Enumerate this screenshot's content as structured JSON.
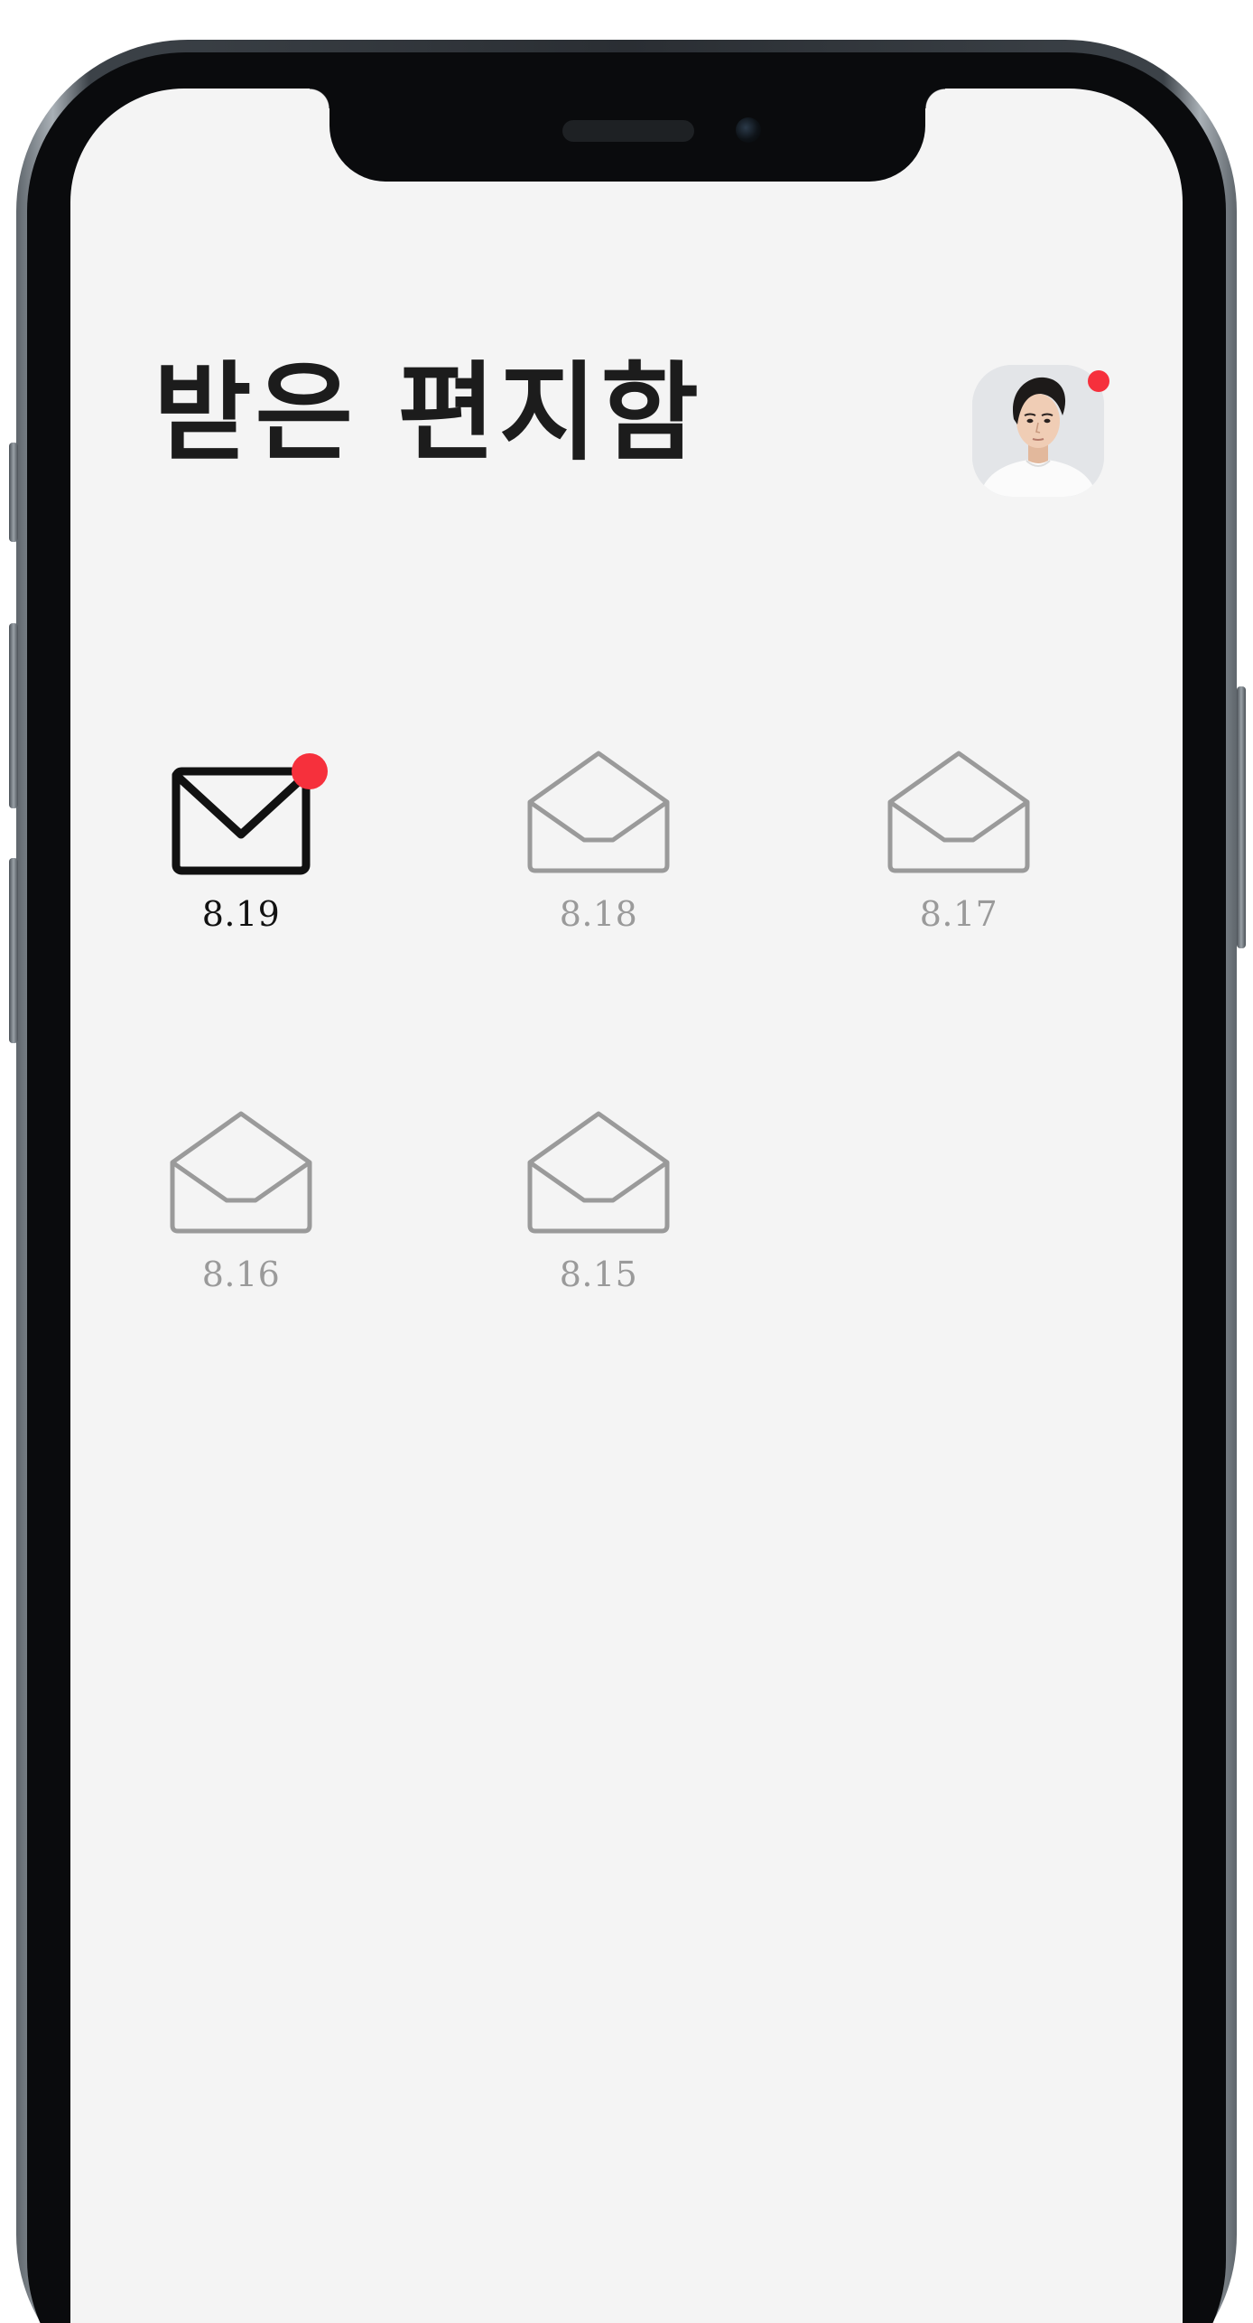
{
  "inbox": {
    "title": "받은 편지함",
    "profile": {
      "has_notification": true,
      "notification_color": "#f6303c"
    },
    "letters": [
      {
        "date": "8.19",
        "status": "unread",
        "icon": "closed-envelope-icon",
        "has_new_badge": true
      },
      {
        "date": "8.18",
        "status": "read",
        "icon": "open-envelope-icon",
        "has_new_badge": false
      },
      {
        "date": "8.17",
        "status": "read",
        "icon": "open-envelope-icon",
        "has_new_badge": false
      },
      {
        "date": "8.16",
        "status": "read",
        "icon": "open-envelope-icon",
        "has_new_badge": false
      },
      {
        "date": "8.15",
        "status": "read",
        "icon": "open-envelope-icon",
        "has_new_badge": false
      }
    ]
  },
  "colors": {
    "screen_background": "#f4f4f4",
    "title_text": "#1c1c1c",
    "unread": "#111111",
    "read": "#9a9a9a",
    "badge": "#f6303c"
  }
}
